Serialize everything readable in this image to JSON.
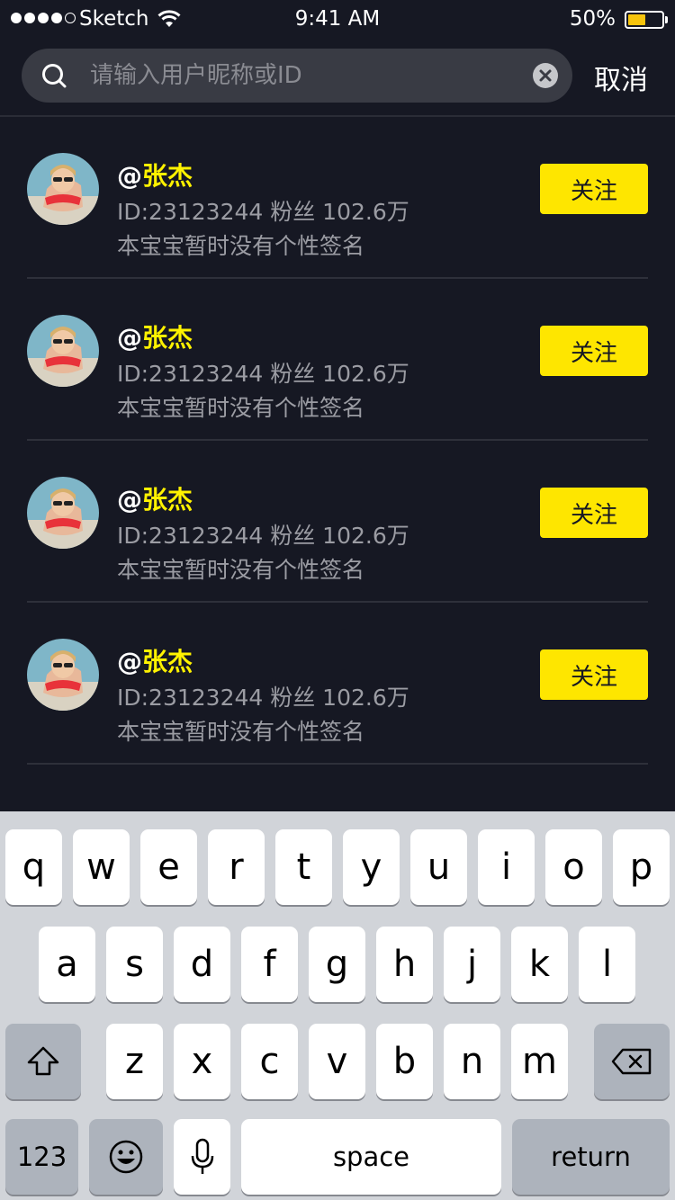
{
  "status_bar": {
    "carrier": "Sketch",
    "time": "9:41 AM",
    "battery": "50%",
    "battery_level": 0.5,
    "battery_color": "#F6C40D"
  },
  "search": {
    "placeholder": "请输入用户昵称或ID",
    "value": "",
    "cancel_label": "取消",
    "search_icon": "search-icon",
    "clear_icon": "clear-icon"
  },
  "theme": {
    "background": "#161823",
    "accent": "#FEE600",
    "name_color": "#FFF200"
  },
  "users": [
    {
      "at": "@",
      "name": "张杰",
      "meta": "ID:23123244  粉丝 102.6万",
      "signature": "本宝宝暂时没有个性签名",
      "follow_label": "关注"
    },
    {
      "at": "@",
      "name": "张杰",
      "meta": "ID:23123244  粉丝 102.6万",
      "signature": "本宝宝暂时没有个性签名",
      "follow_label": "关注"
    },
    {
      "at": "@",
      "name": "张杰",
      "meta": "ID:23123244  粉丝 102.6万",
      "signature": "本宝宝暂时没有个性签名",
      "follow_label": "关注"
    },
    {
      "at": "@",
      "name": "张杰",
      "meta": "ID:23123244  粉丝 102.6万",
      "signature": "本宝宝暂时没有个性签名",
      "follow_label": "关注"
    }
  ],
  "keyboard": {
    "row1": [
      "q",
      "w",
      "e",
      "r",
      "t",
      "y",
      "u",
      "i",
      "o",
      "p"
    ],
    "row2": [
      "a",
      "s",
      "d",
      "f",
      "g",
      "h",
      "j",
      "k",
      "l"
    ],
    "row3": [
      "z",
      "x",
      "c",
      "v",
      "b",
      "n",
      "m"
    ],
    "numbers_label": "123",
    "space_label": "space",
    "return_label": "return"
  }
}
